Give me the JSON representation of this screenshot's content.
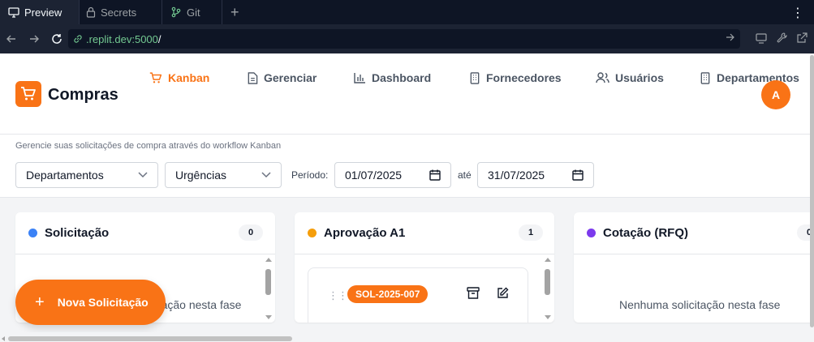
{
  "ide": {
    "tabs": [
      {
        "label": "Preview",
        "icon": "monitor-icon",
        "active": true
      },
      {
        "label": "Secrets",
        "icon": "lock-icon",
        "active": false
      },
      {
        "label": "Git",
        "icon": "git-branch-icon",
        "active": false
      }
    ],
    "new_tab": "+",
    "menu": "⋮",
    "url": {
      "domain": ".replit.dev:5000",
      "path": "/"
    }
  },
  "app": {
    "brand": "Compras",
    "nav": [
      {
        "label": "Kanban",
        "icon": "cart-icon",
        "active": true
      },
      {
        "label": "Gerenciar",
        "icon": "document-icon",
        "active": false
      },
      {
        "label": "Dashboard",
        "icon": "bar-chart-icon",
        "active": false
      },
      {
        "label": "Fornecedores",
        "icon": "building-icon",
        "active": false
      },
      {
        "label": "Usuários",
        "icon": "users-icon",
        "active": false
      },
      {
        "label": "Departamentos",
        "icon": "building-icon",
        "active": false
      }
    ],
    "avatar": "A",
    "subtitle": "Gerencie suas solicitações de compra através do workflow Kanban",
    "filters": {
      "department": "Departamentos",
      "urgency": "Urgências",
      "period_label": "Período:",
      "start_date": "01/07/2025",
      "until_label": "até",
      "end_date": "31/07/2025"
    },
    "columns": [
      {
        "title": "Solicitação",
        "count": "0",
        "color": "#3b82f6",
        "empty_text": "Nenhuma solicitação nesta fase"
      },
      {
        "title": "Aprovação A1",
        "count": "1",
        "color": "#f59e0b"
      },
      {
        "title": "Cotação (RFQ)",
        "count": "0",
        "color": "#7c3aed",
        "empty_text": "Nenhuma solicitação nesta fase"
      }
    ],
    "card": {
      "id": "SOL-2025-007"
    },
    "fab": {
      "label": "Nova Solicitação",
      "plus": "+"
    },
    "accent": "#f97316"
  }
}
